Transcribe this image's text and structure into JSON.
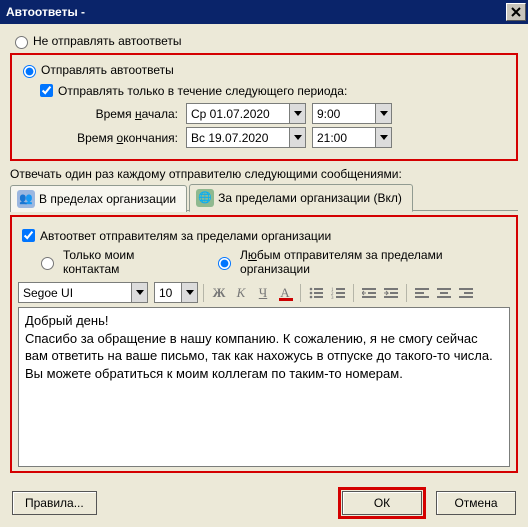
{
  "window": {
    "title": "Автоответы -"
  },
  "radios": {
    "dont_send": "Не отправлять автоответы",
    "send": "Отправлять автоответы"
  },
  "period": {
    "only_within_label": "Отправлять только в течение следующего периода:",
    "start_label_pre": "Время ",
    "start_label_u": "н",
    "start_label_post": "ачала:",
    "end_label_pre": "Время ",
    "end_label_u": "о",
    "end_label_post": "кончания:",
    "start_date": "Ср 01.07.2020",
    "start_time": "9:00",
    "end_date": "Вс 19.07.2020",
    "end_time": "21:00"
  },
  "reply_label": "Отвечать один раз каждому отправителю следующими сообщениями:",
  "tabs": {
    "inside": "В пределах организации",
    "outside": "За пределами организации (Вкл)"
  },
  "outside": {
    "auto_label": "Автоответ отправителям за пределами организации",
    "only_contacts": "Только моим контактам",
    "any_sender_pre": "Л",
    "any_sender_u": "ю",
    "any_sender_post": "бым отправителям за пределами организации"
  },
  "editor": {
    "font": "Segoe UI",
    "size": "10",
    "toolbar": {
      "bold": "Ж",
      "italic": "К",
      "underline": "Ч",
      "color": "А"
    },
    "body_l1": "Добрый день!",
    "body_l2": "Спасибо за обращение в нашу компанию. К сожалению, я не смогу сейчас вам ответить на ваше письмо, так как нахожусь в отпуске до такого-то числа. Вы можете обратиться к моим коллегам по таким-то номерам."
  },
  "buttons": {
    "rules": "Правила...",
    "ok": "ОК",
    "cancel": "Отмена"
  }
}
